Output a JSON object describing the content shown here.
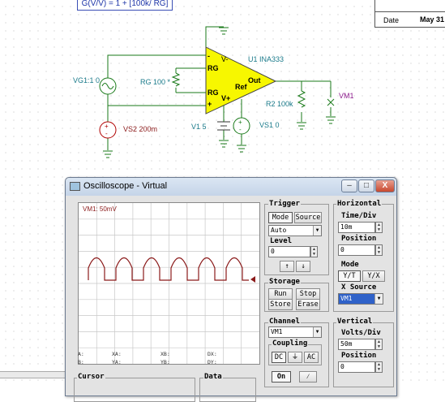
{
  "schematic": {
    "formula": "G(V/V) = 1 + [100k/ RG]",
    "titleblock": {
      "date_label": "Date",
      "date_value": "May 31"
    },
    "labels": {
      "vg1": "VG1:1 0",
      "vs2": "VS2 200m",
      "rg": "RG 100 *",
      "u1": "U1 INA333",
      "v1": "V1 5",
      "vs1": "VS1 0",
      "r2": "R2 100k",
      "vm1": "VM1"
    },
    "pins": {
      "vminus": "V-",
      "rg1": "RG",
      "rg2": "RG",
      "ref": "Ref",
      "out": "Out",
      "vplus": "V+",
      "minus": "-",
      "plus": "+"
    }
  },
  "oscilloscope": {
    "title": "Oscilloscope - Virtual",
    "window_buttons": {
      "minimize": "–",
      "maximize": "□",
      "close": "X"
    },
    "screen": {
      "channel_label": "VM1: 50mV"
    },
    "readouts": {
      "a": "A:",
      "b": "B:",
      "xa": "XA:",
      "ya": "YA:",
      "xb": "XB:",
      "yb": "YB:",
      "dx": "DX:",
      "dy": "DY:"
    },
    "trigger": {
      "title": "Trigger",
      "mode_button": "Mode",
      "source_button": "Source",
      "mode_value": "Auto",
      "level_label": "Level",
      "level_value": "0",
      "rising_icon": "rising-edge-icon",
      "falling_icon": "falling-edge-icon"
    },
    "storage": {
      "title": "Storage",
      "run": "Run",
      "stop": "Stop",
      "store": "Store",
      "erase": "Erase"
    },
    "horizontal": {
      "title": "Horizontal",
      "time_div_label": "Time/Div",
      "time_div_value": "10m",
      "position_label": "Position",
      "position_value": "0",
      "mode_label": "Mode",
      "mode_yt": "Y/T",
      "mode_yx": "Y/X",
      "xsource_label": "X Source",
      "xsource_value": "VM1"
    },
    "channel": {
      "title": "Channel",
      "value": "VM1",
      "coupling_label": "Coupling",
      "dc": "DC",
      "ac": "AC",
      "on": "On"
    },
    "vertical": {
      "title": "Vertical",
      "volts_div_label": "Volts/Div",
      "volts_div_value": "50m",
      "position_label": "Position",
      "position_value": "0"
    },
    "cursor": {
      "title": "Cursor"
    },
    "data": {
      "title": "Data"
    }
  },
  "colors": {
    "opamp_fill": "#f7f700",
    "wire": "#1a7a1a",
    "trace": "#8b1a1a",
    "label": "#1a7a8a",
    "formula": "#1f36a8",
    "selection": "#2f62c9"
  }
}
